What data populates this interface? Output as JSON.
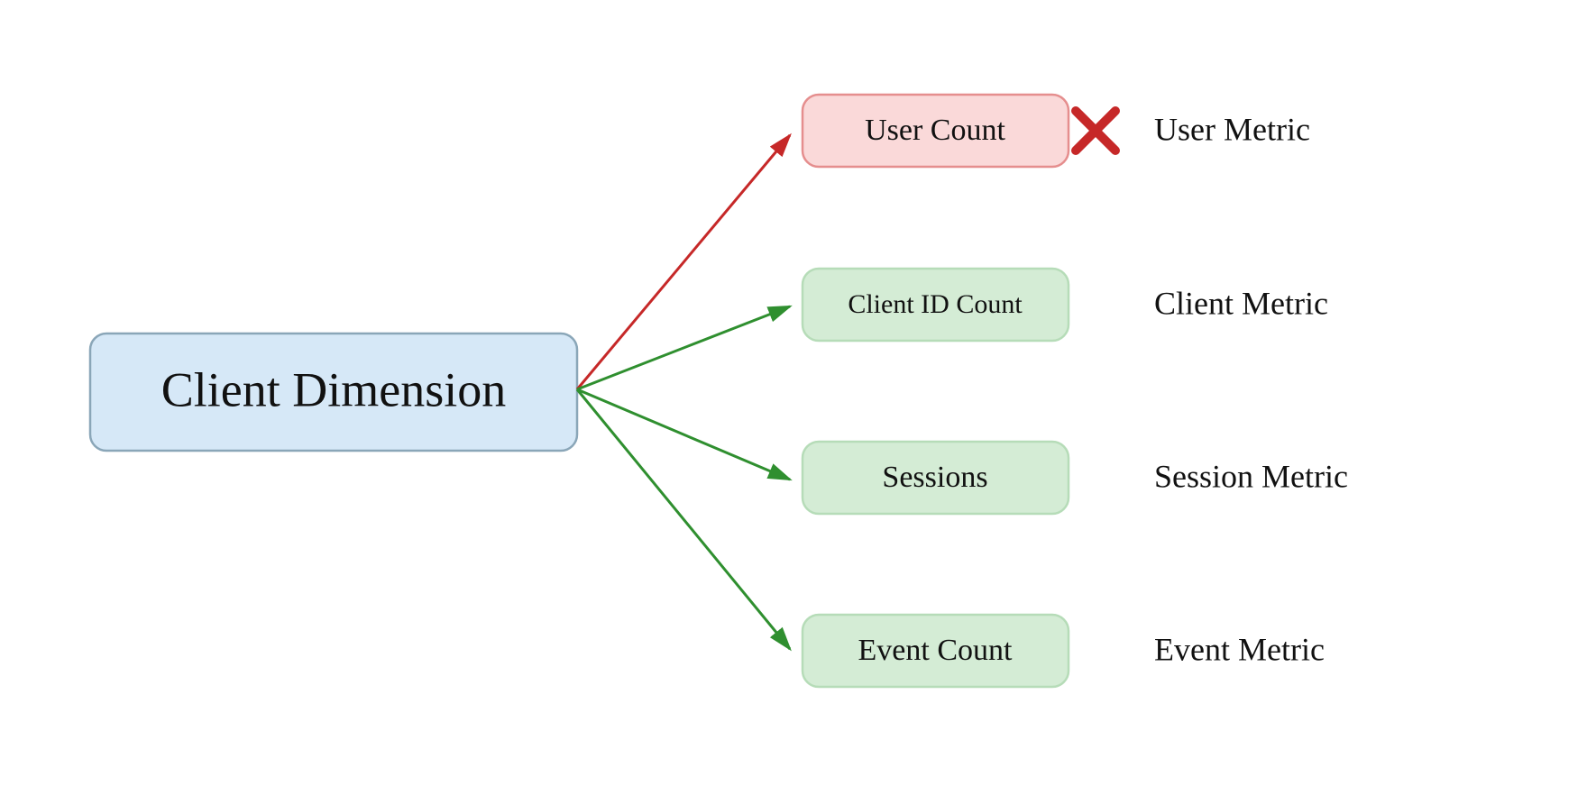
{
  "diagram": {
    "source": {
      "label": "Client Dimension"
    },
    "targets": [
      {
        "label": "User Count",
        "metric": "User Metric",
        "status": "invalid",
        "color": "red"
      },
      {
        "label": "Client ID Count",
        "metric": "Client Metric",
        "status": "valid",
        "color": "green"
      },
      {
        "label": "Sessions",
        "metric": "Session Metric",
        "status": "valid",
        "color": "green"
      },
      {
        "label": "Event Count",
        "metric": "Event Metric",
        "status": "valid",
        "color": "green"
      }
    ],
    "colors": {
      "arrow_valid": "#2f8f2f",
      "arrow_invalid": "#c62828",
      "box_source_fill": "#d6e8f7",
      "box_red_fill": "#fad9d9",
      "box_green_fill": "#d4ecd5"
    }
  }
}
